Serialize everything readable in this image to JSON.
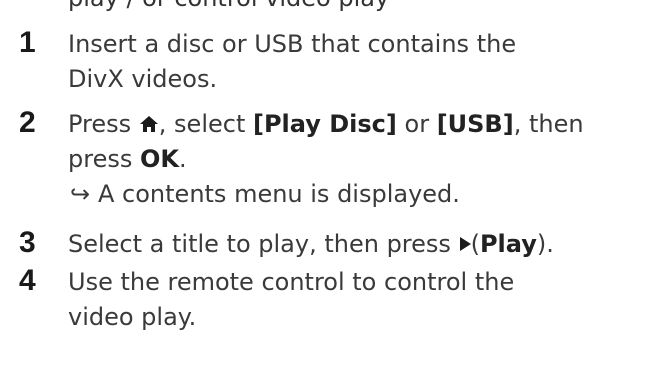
{
  "top_fragment": "play / or control video play",
  "steps": [
    {
      "number": "1",
      "line1": "Insert a disc or USB that contains the",
      "line2": "DivX videos."
    },
    {
      "number": "2",
      "press": "Press ",
      "icon": "home-icon",
      "select": ", select ",
      "play_disc": "[Play Disc]",
      "or": " or ",
      "usb": "[USB]",
      "then": ", then",
      "press2": "press ",
      "ok": "OK",
      "period": ".",
      "arrow": "↪",
      "result": "A contents menu is displayed."
    },
    {
      "number": "3",
      "text": "Select a title to play, then press ",
      "icon": "play-icon",
      "paren_open": "(",
      "play": "Play",
      "paren_close": ")."
    },
    {
      "number": "4",
      "line1": "Use the remote control to control the",
      "line2": "video play."
    }
  ]
}
